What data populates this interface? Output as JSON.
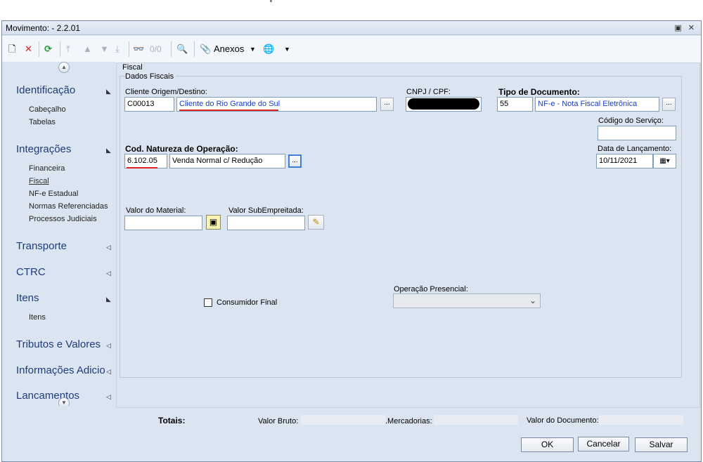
{
  "window": {
    "title": "Movimento:  - 2.2.01"
  },
  "toolbar": {
    "counter": "0/0",
    "anexos_label": "Anexos"
  },
  "sidebar": {
    "sections": [
      {
        "label": "Identificação",
        "items": [
          "Cabeçalho",
          "Tabelas"
        ]
      },
      {
        "label": "Integrações",
        "items": [
          "Financeira",
          "Fiscal",
          "NF-e Estadual",
          "Normas Referenciadas",
          "Processos Judiciais"
        ]
      },
      {
        "label": "Transporte",
        "items": []
      },
      {
        "label": "CTRC",
        "items": []
      },
      {
        "label": "Itens",
        "items": [
          "Itens"
        ]
      },
      {
        "label": "Tributos e Valores",
        "items": []
      },
      {
        "label": "Informações Adicio",
        "items": []
      },
      {
        "label": "Lancamentos",
        "items": []
      }
    ]
  },
  "form": {
    "tab_label": "Fiscal",
    "group_label": "Dados Fiscais",
    "cliente_label": "Cliente Origem/Destino:",
    "cliente_code": "C00013",
    "cliente_name": "Cliente do Rio Grande do Sul",
    "cnpj_label": "CNPJ / CPF:",
    "tipo_doc_label": "Tipo de Documento:",
    "tipo_doc_code": "55",
    "tipo_doc_name": "NF-e - Nota Fiscal Eletrônica",
    "codigo_servico_label": "Código do Serviço:",
    "codigo_servico_value": "",
    "natureza_label": "Cod. Natureza de Operação:",
    "natureza_code": "6.102.05",
    "natureza_name": "Venda Normal c/ Redução",
    "data_lanc_label": "Data de Lançamento:",
    "data_lanc_value": "10/11/2021",
    "valor_material_label": "Valor do Material:",
    "valor_material_value": "",
    "valor_sub_label": "Valor SubEmpreitada:",
    "valor_sub_value": "",
    "consumidor_label": "Consumidor Final",
    "consumidor_checked": false,
    "operacao_label": "Operação Presencial:",
    "operacao_value": ""
  },
  "totals": {
    "label": "Totais:",
    "valor_bruto_label": "Valor Bruto:",
    "mercadorias_label": ".Mercadorias:",
    "valor_documento_label": "Valor do Documento:"
  },
  "buttons": {
    "ok": "OK",
    "cancel": "Cancelar",
    "save": "Salvar"
  },
  "colors": {
    "accent_red": "#e02020",
    "link_blue": "#1a3fbf",
    "panel_bg": "#dbe5f1"
  }
}
